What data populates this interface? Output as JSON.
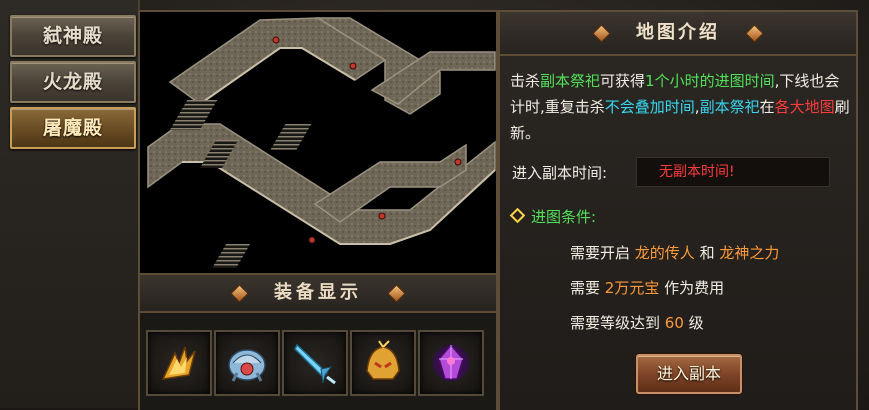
{
  "nav": {
    "items": [
      {
        "label": "弑神殿",
        "active": false
      },
      {
        "label": "火龙殿",
        "active": false
      },
      {
        "label": "屠魔殿",
        "active": true
      }
    ]
  },
  "equipment": {
    "title": "装备显示",
    "slots": [
      {
        "icon": "flame-blade-icon"
      },
      {
        "icon": "dragon-armor-icon"
      },
      {
        "icon": "ice-sword-icon"
      },
      {
        "icon": "golden-helmet-icon"
      },
      {
        "icon": "purple-gem-icon"
      }
    ]
  },
  "info": {
    "title": "地图介绍",
    "desc": {
      "p1": "击杀",
      "p2": "副本祭祀",
      "p3": "可获得",
      "p4": "1个小时的进图时间",
      "p5": ",下线也会计时,重复击杀",
      "p6": "不会叠加时间",
      "p7": ",",
      "p8": "副本祭祀",
      "p9": "在",
      "p10": "各大地图",
      "p11": "刷新。"
    },
    "time_label": "进入副本时间:",
    "time_value": "无副本时间!",
    "cond_title": "进图条件:",
    "req1": {
      "a": "需要开启 ",
      "b": "龙的传人",
      "c": " 和 ",
      "d": "龙神之力"
    },
    "req2": {
      "a": "需要 ",
      "b": "2万元宝",
      "c": " 作为费用"
    },
    "req3": {
      "a": "需要等级达到 ",
      "b": "60",
      "c": " 级"
    },
    "enter_label": "进入副本"
  },
  "colors": {
    "green": "#52e05a",
    "cyan": "#38d6f0",
    "red": "#ff3b3b",
    "orange": "#ff9a3a"
  }
}
